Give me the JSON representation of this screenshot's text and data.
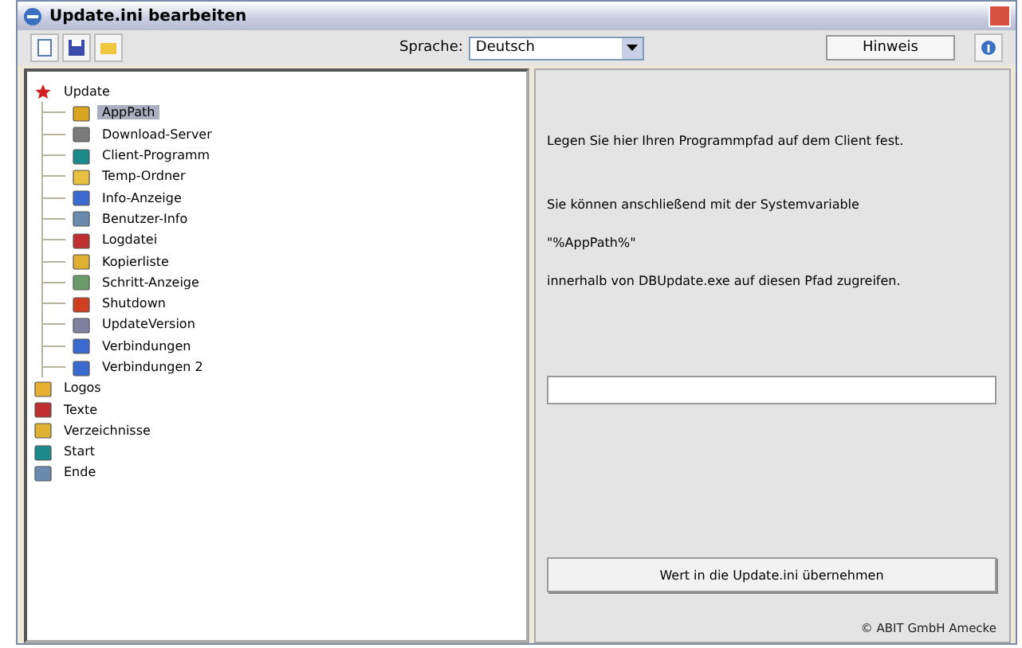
{
  "window": {
    "title": "Update.ini bearbeiten"
  },
  "toolbar": {
    "language_label": "Sprache:",
    "language_value": "Deutsch",
    "hint_button": "Hinweis"
  },
  "tree": [
    {
      "label": "Update",
      "children": [
        {
          "label": "AppPath",
          "selected": true
        },
        {
          "label": "Download-Server",
          "selected": false
        },
        {
          "label": "Client-Programm",
          "selected": false
        },
        {
          "label": "Temp-Ordner",
          "selected": false
        },
        {
          "label": "Info-Anzeige",
          "selected": false
        },
        {
          "label": "Benutzer-Info",
          "selected": false
        },
        {
          "label": "Logdatei",
          "selected": false
        },
        {
          "label": "Kopierliste",
          "selected": false
        },
        {
          "label": "Schritt-Anzeige",
          "selected": false
        },
        {
          "label": "Shutdown",
          "selected": false
        },
        {
          "label": "UpdateVersion",
          "selected": false
        },
        {
          "label": "Verbindungen",
          "selected": false
        },
        {
          "label": "Verbindungen 2",
          "selected": false
        }
      ]
    },
    {
      "label": "Logos"
    },
    {
      "label": "Texte"
    },
    {
      "label": "Verzeichnisse"
    },
    {
      "label": "Start"
    },
    {
      "label": "Ende"
    }
  ],
  "detail": {
    "paragraphs": [
      "Legen Sie hier Ihren Programmpfad auf dem Client fest.",
      "Sie können anschließend mit der Systemvariable",
      "\"%AppPath%\"",
      "innerhalb von DBUpdate.exe auf diesen Pfad zugreifen."
    ],
    "apply_button": "Wert in die Update.ini übernehmen",
    "footer": "© ABIT GmbH Amecke"
  }
}
